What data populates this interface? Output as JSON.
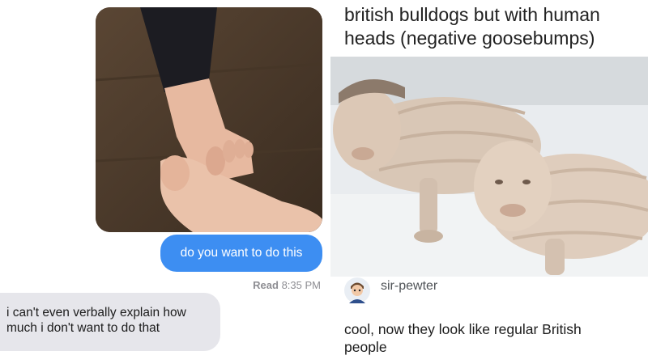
{
  "conversation": {
    "sent_message": "do you want to do this",
    "read_receipt": {
      "status": "Read",
      "time": "8:35 PM"
    },
    "received_message_lines": [
      "i can't even verbally explain how",
      "much i don't want to do that"
    ],
    "bubble_colors": {
      "sent": "#3d8ef2",
      "received": "#e6e6eb"
    }
  },
  "post": {
    "title_lines": [
      "british bulldogs but with human",
      "heads (negative goosebumps)"
    ],
    "comment": {
      "username": "sir-pewter",
      "text_lines": [
        "cool, now they look like regular British",
        "people"
      ]
    }
  }
}
